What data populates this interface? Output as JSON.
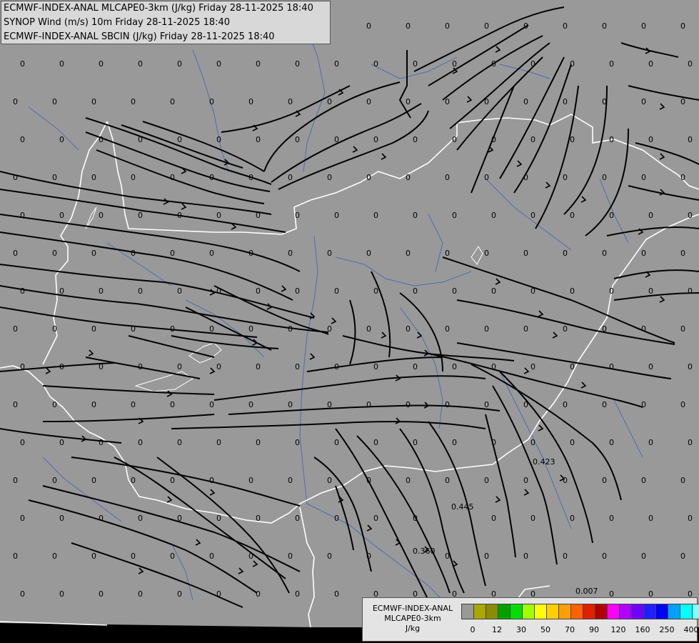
{
  "header": {
    "line1": "ECMWF-INDEX-ANAL MLCAPE0-3km (J/kg) Friday 28-11-2025 18:40",
    "line2": "SYNOP Wind (m/s) 10m Friday 28-11-2025 18:40",
    "line3": "ECMWF-INDEX-ANAL SBCIN (J/kg) Friday 28-11-2025 18:40"
  },
  "legend": {
    "title_line1": "ECMWF-INDEX-ANAL",
    "title_line2": "MLCAPE0-3km",
    "title_line3": "J/kg",
    "colors": [
      "#999999",
      "#a8a800",
      "#8c8c00",
      "#00a000",
      "#00e000",
      "#a0ff00",
      "#ffff00",
      "#ffd000",
      "#ffa000",
      "#ff6000",
      "#e02000",
      "#b00000",
      "#ff00ff",
      "#b000ff",
      "#7000ff",
      "#2020ff",
      "#0000ff",
      "#00a0ff",
      "#00ffff",
      "#80ffff",
      "#ffffff"
    ],
    "tick_labels": [
      "0",
      "12",
      "30",
      "50",
      "70",
      "90",
      "120",
      "160",
      "250",
      "400"
    ]
  },
  "map": {
    "background_color": "#999999",
    "border_color": "#ffffff",
    "river_color": "#4a6fb0",
    "streamline_color": "#000000",
    "nonzero_values": [
      "0.423",
      "0.445",
      "0.360",
      "0.007"
    ],
    "zero_label": "0"
  }
}
